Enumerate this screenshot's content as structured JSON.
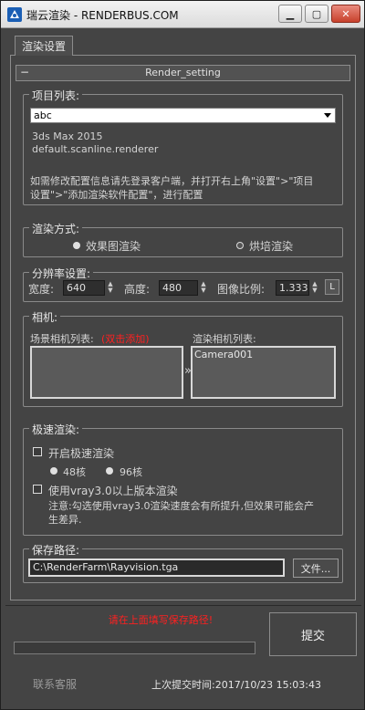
{
  "titlebar": {
    "title": "瑞云渲染 - RENDERBUS.COM",
    "min_glyph": "▁",
    "max_glyph": "▢",
    "close_glyph": "✕"
  },
  "tab": {
    "label": "渲染设置"
  },
  "rollout": {
    "toggle": "−",
    "title": "Render_setting"
  },
  "project": {
    "legend": "项目列表:",
    "selected": "abc",
    "software": "3ds Max 2015",
    "renderer": "default.scanline.renderer",
    "hint_line1": "如需修改配置信息请先登录客户端，并打开右上角\"设置\">\"项目",
    "hint_line2": "设置\">\"添加渲染软件配置\"，进行配置"
  },
  "render_mode": {
    "legend": "渲染方式:",
    "option1": "效果图渲染",
    "option2": "烘培渲染",
    "selected": "option1"
  },
  "resolution": {
    "legend": "分辨率设置:",
    "width_label": "宽度:",
    "width": "640",
    "height_label": "高度:",
    "height": "480",
    "ratio_label": "图像比例:",
    "ratio": "1.333",
    "lock_label": "L"
  },
  "camera": {
    "legend": "相机:",
    "scene_label": "场景相机列表:",
    "scene_note": "(双击添加)",
    "render_label": "渲染相机列表:",
    "render_items": [
      "Camera001"
    ],
    "transfer_glyph": "»"
  },
  "fast_render": {
    "legend": "极速渲染:",
    "enable_label": "开启极速渲染",
    "core48": "48核",
    "core96": "96核",
    "vray_label": "使用vray3.0以上版本渲染",
    "note_line1": "注意:勾选使用vray3.0渲染速度会有所提升,但效果可能会产",
    "note_line2": "生差异."
  },
  "save_path": {
    "legend": "保存路径:",
    "value": "C:\\RenderFarm\\Rayvision.tga",
    "file_button": "文件..."
  },
  "bottom": {
    "status": "请在上面填写保存路径!",
    "progress_fraction": 0.0,
    "submit_label": "提交",
    "contact_label": "联系客服",
    "last_submit": "上次提交时间:2017/10/23 15:03:43"
  },
  "colors": {
    "status_red": "#ff2020",
    "title_close": "#c8412c"
  }
}
